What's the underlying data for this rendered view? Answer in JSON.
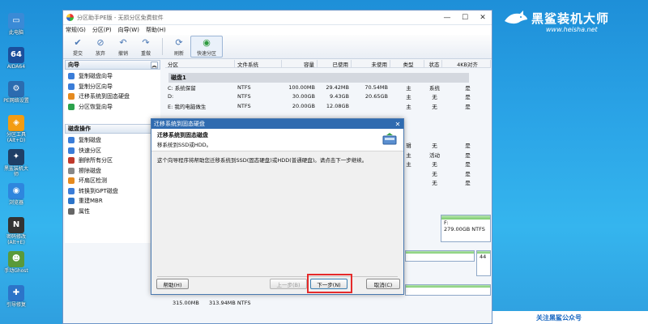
{
  "desktop": {
    "icons": [
      {
        "label": "此电脑",
        "icon": "computer-icon",
        "color": "#3a8ad6",
        "glyph": "▭"
      },
      {
        "label": "AIDA64",
        "icon": "aida64-icon",
        "color": "#1b4f9c",
        "glyph": "64"
      },
      {
        "label": "PE网络设置",
        "icon": "network-icon",
        "color": "#2b6cb0",
        "glyph": "⚙"
      },
      {
        "label": "分区工具\n(Alt+D)",
        "icon": "partition-tool-icon",
        "color": "#f39c12",
        "glyph": "◈"
      },
      {
        "label": "黑鲨装机大\n师",
        "icon": "shark-installer-icon",
        "color": "#1f3f66",
        "glyph": "✦"
      },
      {
        "label": "浏览器",
        "icon": "browser-icon",
        "color": "#2e86de",
        "glyph": "◉"
      },
      {
        "label": "密码修改\n(Alt+E)",
        "icon": "password-icon",
        "color": "#333333",
        "glyph": "N"
      },
      {
        "label": "手动Ghost",
        "icon": "ghost-icon",
        "color": "#5a9a3a",
        "glyph": "☻"
      },
      {
        "label": "引导修复",
        "icon": "boot-repair-icon",
        "color": "#2c74c9",
        "glyph": "✚"
      }
    ]
  },
  "watermark": {
    "title": "黑鲨装机大师",
    "url": "www.heisha.net",
    "wechat": "关注黑鲨公众号"
  },
  "window": {
    "title": "分区助手PE版 - 无损分区免费软件",
    "menu": [
      "常规(G)",
      "分区(P)",
      "向导(W)",
      "帮助(H)"
    ],
    "toolbar": {
      "submit": "提交",
      "discard": "放弃",
      "undo": "撤销",
      "redo": "重做",
      "refresh": "刷新",
      "quick_partition": "快速分区"
    }
  },
  "sidebar": {
    "wizard_title": "向导",
    "wizard_items": [
      "复制磁盘向导",
      "复制分区向导",
      "迁移系统到固态硬盘",
      "分区恢复向导"
    ],
    "disk_ops_title": "磁盘操作",
    "disk_ops_items": [
      "复制磁盘",
      "快速分区",
      "删除所有分区",
      "擦除磁盘",
      "坏扇区检测",
      "转换到GPT磁盘",
      "重建MBR",
      "属性"
    ]
  },
  "grid": {
    "headers": [
      "分区",
      "文件系统",
      "容量",
      "已使用",
      "未使用",
      "类型",
      "状态",
      "4KB对齐"
    ],
    "disk_label": "磁盘1",
    "rows": [
      [
        "C: 系统保留",
        "NTFS",
        "100.00MB",
        "29.42MB",
        "70.54MB",
        "主",
        "系统",
        "是"
      ],
      [
        "D:",
        "NTFS",
        "30.00GB",
        "9.43GB",
        "20.65GB",
        "主",
        "无",
        "是"
      ],
      [
        "E: 我的电脑做生",
        "NTFS",
        "20.00GB",
        "12.08GB",
        "",
        "主",
        "无",
        "是"
      ]
    ],
    "partial_rows": [
      {
        "type": "辑",
        "status": "无",
        "align": "是"
      },
      {
        "type": "主",
        "status": "活动",
        "align": "是"
      },
      {
        "type": "主",
        "status": "无",
        "align": "是"
      },
      {
        "type": "",
        "status": "无",
        "align": "是"
      },
      {
        "type": "",
        "status": "无",
        "align": "是"
      }
    ]
  },
  "diskmap": {
    "f_size": "F:",
    "f_detail": "279.00GB NTFS",
    "small_label": "44",
    "bottom_size": "315.00MB",
    "bottom_detail": "313.94MB NTFS"
  },
  "dialog": {
    "title": "迁移系统到固态硬盘",
    "heading": "迁移系统到固态磁盘",
    "subheading": "移系统到SSD或HDD。",
    "body": "这个向导程序将帮助您迁移系统到SSD(固态硬盘)或HDD(普通硬盘)。请点击下一步继续。",
    "help": "帮助(H)",
    "prev": "上一步(B)",
    "next": "下一步(N)",
    "cancel": "取消(C)"
  },
  "colors": {
    "accent": "#2f6bb0",
    "highlight": "#e52b2b",
    "bar_fill": "#7ccb6c"
  }
}
